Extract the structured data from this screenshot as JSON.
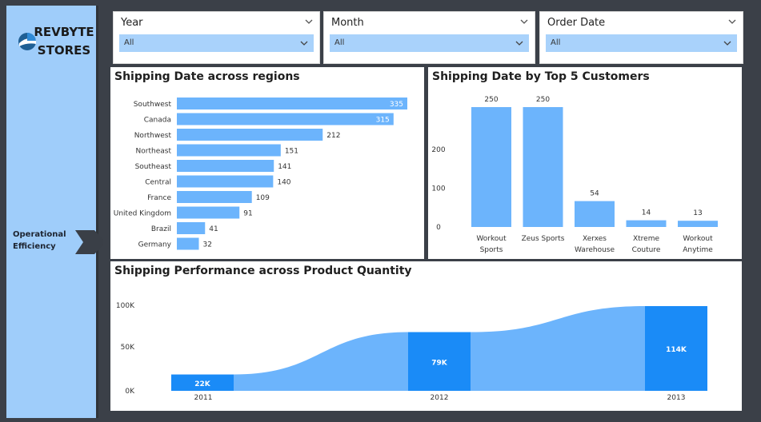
{
  "brand": {
    "line1": "REVBYTE",
    "line2": "STORES"
  },
  "sidebar": {
    "nav_label_line1": "Operational",
    "nav_label_line2": "Efficiency"
  },
  "slicers": [
    {
      "title": "Year",
      "value": "All"
    },
    {
      "title": "Month",
      "value": "All"
    },
    {
      "title": "Order Date",
      "value": "All"
    }
  ],
  "colors": {
    "bar": "#6cb4fc",
    "bar_dark": "#1a8bf7",
    "sidebar": "#9fcdfa",
    "background": "#3b4048"
  },
  "regions_chart": {
    "title": "Shipping Date across regions",
    "chart_data": {
      "type": "bar",
      "orientation": "horizontal",
      "categories": [
        "Southwest",
        "Canada",
        "Northwest",
        "Northeast",
        "Southeast",
        "Central",
        "France",
        "United Kingdom",
        "Brazil",
        "Germany"
      ],
      "values": [
        335,
        315,
        212,
        151,
        141,
        140,
        109,
        91,
        41,
        32
      ],
      "labels": [
        "335",
        "315",
        "212",
        "151",
        "141",
        "140",
        "109",
        "91",
        "41",
        "32"
      ]
    }
  },
  "customers_chart": {
    "title": "Shipping Date by Top 5 Customers",
    "chart_data": {
      "type": "bar",
      "categories": [
        [
          "Workout",
          "Sports"
        ],
        [
          "Zeus Sports",
          ""
        ],
        [
          "Xerxes",
          "Warehouse"
        ],
        [
          "Xtreme",
          "Couture"
        ],
        [
          "Workout",
          "Anytime"
        ]
      ],
      "values": [
        250,
        250,
        54,
        14,
        13
      ],
      "labels": [
        "250",
        "250",
        "54",
        "14",
        "13"
      ],
      "y_ticks": [
        "0",
        "100",
        "200"
      ],
      "ylim": [
        0,
        280
      ]
    }
  },
  "performance_chart": {
    "title": "Shipping Performance across Product Quantity",
    "chart_data": {
      "type": "area",
      "categories": [
        "2011",
        "2012",
        "2013"
      ],
      "values": [
        22000,
        79000,
        114000
      ],
      "labels": [
        "22K",
        "79K",
        "114K"
      ],
      "y_ticks": [
        "0K",
        "50K",
        "100K"
      ],
      "ylim": [
        0,
        120000
      ]
    }
  }
}
